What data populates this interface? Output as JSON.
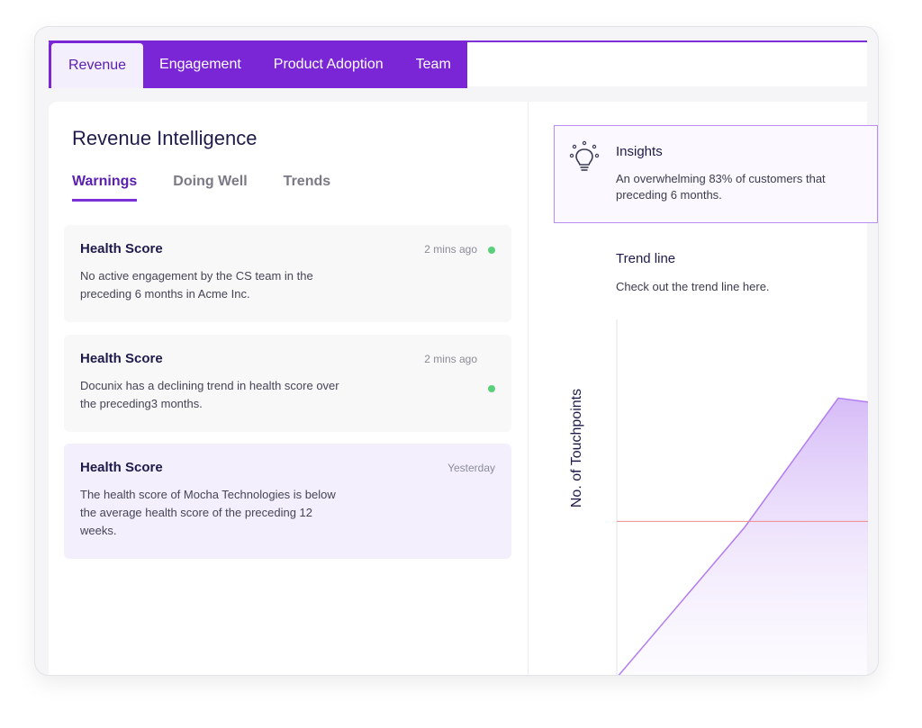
{
  "tabs": [
    {
      "label": "Revenue",
      "active": true
    },
    {
      "label": "Engagement",
      "active": false
    },
    {
      "label": "Product Adoption",
      "active": false
    },
    {
      "label": "Team",
      "active": false
    }
  ],
  "left": {
    "title": "Revenue Intelligence",
    "subtabs": [
      {
        "label": "Warnings",
        "active": true
      },
      {
        "label": "Doing Well",
        "active": false
      },
      {
        "label": "Trends",
        "active": false
      }
    ],
    "cards": [
      {
        "title": "Health Score",
        "time": "2 mins ago",
        "body": "No active engagement by the CS team in the preceding 6 months in Acme Inc.",
        "status": "green"
      },
      {
        "title": "Health Score",
        "time": "2 mins ago",
        "body": "Docunix has a declining trend in health score over the preceding3 months.",
        "status": "green"
      },
      {
        "title": "Health Score",
        "time": "Yesterday",
        "body": "The health score of Mocha Technologies is below  the average health score of the preceding 12 weeks.",
        "status": "none"
      }
    ]
  },
  "right": {
    "insights_title": "Insights",
    "insights_line1": "An overwhelming 83% of customers that",
    "insights_line2": "preceding 6 months.",
    "icon": "lightbulb-icon",
    "trend_title": "Trend line",
    "trend_subtitle": "Check out the trend line here."
  },
  "colors": {
    "accent": "#7b26d6",
    "status_green": "#5bd07a",
    "reference_line": "#f08a8a"
  },
  "chart_data": {
    "type": "area",
    "ylabel": "No. of Touchpoints",
    "xlabel": "",
    "series": [
      {
        "values": [
          0,
          0.5,
          0.93,
          0.9
        ]
      }
    ],
    "reference_line": 0.52
  }
}
